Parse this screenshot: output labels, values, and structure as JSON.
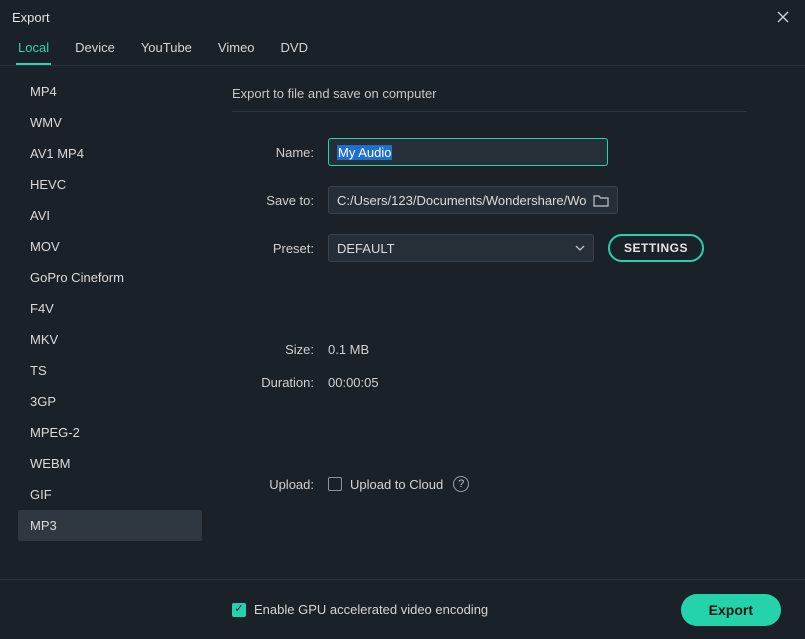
{
  "window": {
    "title": "Export"
  },
  "tabs": {
    "items": [
      "Local",
      "Device",
      "YouTube",
      "Vimeo",
      "DVD"
    ],
    "active": "Local"
  },
  "formats": {
    "items": [
      "MP4",
      "WMV",
      "AV1 MP4",
      "HEVC",
      "AVI",
      "MOV",
      "GoPro Cineform",
      "F4V",
      "MKV",
      "TS",
      "3GP",
      "MPEG-2",
      "WEBM",
      "GIF",
      "MP3"
    ],
    "selected": "MP3"
  },
  "main": {
    "description": "Export to file and save on computer",
    "name_label": "Name:",
    "name_value": "My Audio",
    "saveto_label": "Save to:",
    "saveto_value": "C:/Users/123/Documents/Wondershare/Wo",
    "preset_label": "Preset:",
    "preset_value": "DEFAULT",
    "settings_button": "SETTINGS",
    "size_label": "Size:",
    "size_value": "0.1 MB",
    "duration_label": "Duration:",
    "duration_value": "00:00:05",
    "upload_label": "Upload:",
    "upload_checkbox_label": "Upload to Cloud",
    "upload_checked": false
  },
  "footer": {
    "gpu_label": "Enable GPU accelerated video encoding",
    "gpu_checked": true,
    "export_button": "Export"
  }
}
